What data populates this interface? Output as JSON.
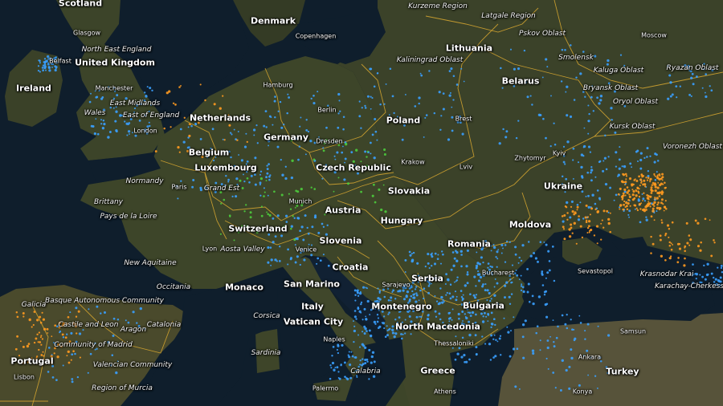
{
  "map": {
    "colors": {
      "sea": "#0f1e2c",
      "land": "#3a4128",
      "land_dark": "#2c3320",
      "border": "#d9a830",
      "dot_blue": "#3aa0ff",
      "dot_orange": "#ff9a1f",
      "dot_green": "#4ccb3c"
    },
    "labels": {
      "countries": [
        "Scotland",
        "Denmark",
        "United Kingdom",
        "Lithuania",
        "Ireland",
        "Belarus",
        "Netherlands",
        "Poland",
        "Germany",
        "Belgium",
        "Luxembourg",
        "Czech Republic",
        "Slovakia",
        "Ukraine",
        "Austria",
        "Hungary",
        "Moldova",
        "Switzerland",
        "Slovenia",
        "Romania",
        "Croatia",
        "Monaco",
        "San Marino",
        "Serbia",
        "Italy",
        "Montenegro",
        "Bulgaria",
        "Vatican City",
        "North Macedonia",
        "Portugal",
        "Greece",
        "Turkey"
      ],
      "regions": [
        "Kurzeme Region",
        "Latgale Region",
        "North East England",
        "Kaliningrad Oblast",
        "Pskov Oblast",
        "Smolensk",
        "Kaluga Oblast",
        "Bryansk Oblast",
        "Oryol Oblast",
        "Ryazan Oblast",
        "Kursk Oblast",
        "Voronezh Oblast",
        "East Midlands",
        "Wales",
        "East of England",
        "Normandy",
        "Brittany",
        "Grand Est",
        "Pays de la Loire",
        "New Aquitaine",
        "Occitania",
        "Aosta Valley",
        "Basque Autonomous Community",
        "Galicia",
        "Castile and Leon",
        "Aragon",
        "Catalonia",
        "Community of Madrid",
        "Valencian Community",
        "Region of Murcia",
        "Corsica",
        "Sardinia",
        "Calabria",
        "Krasnodar Krai",
        "Karachay-Cherkessia"
      ],
      "cities": [
        "Glasgow",
        "Belfast",
        "Copenhagen",
        "Moscow",
        "Manchester",
        "Hamburg",
        "Berlin",
        "London",
        "Brest",
        "Dresden",
        "Zhytomyr",
        "Kyiv",
        "Krakow",
        "Lviv",
        "Paris",
        "Munich",
        "Lyon",
        "Venice",
        "Sarajevo",
        "Bucharest",
        "Sevastopol",
        "Naples",
        "Thessaloniki",
        "Lisbon",
        "Palermo",
        "Athens",
        "Samsun",
        "Ankara",
        "Konya"
      ]
    }
  }
}
